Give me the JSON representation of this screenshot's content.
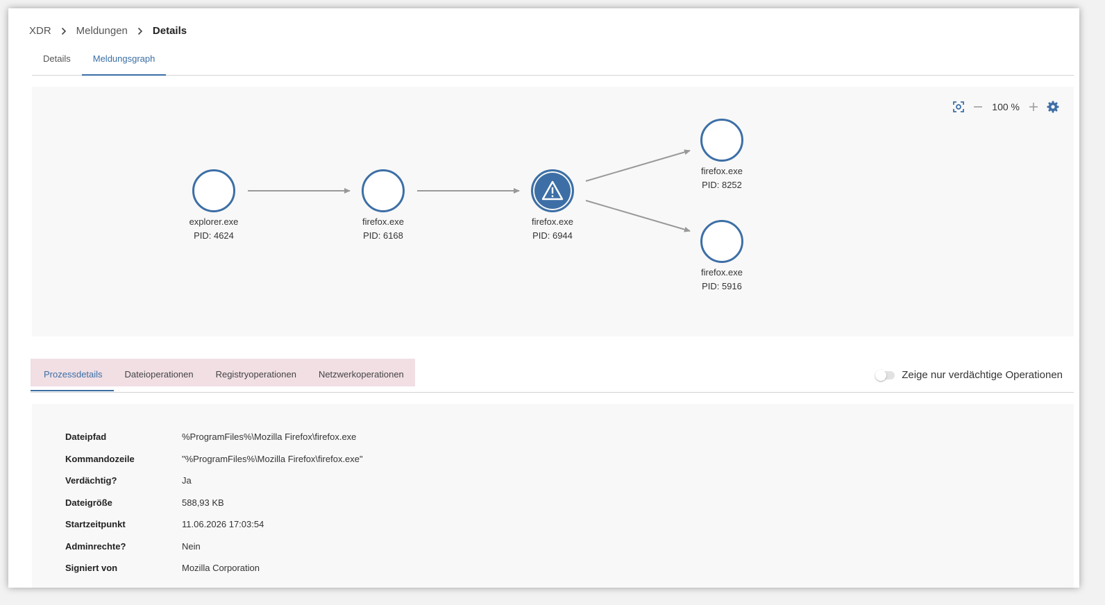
{
  "breadcrumb": [
    "XDR",
    "Meldungen",
    "Details"
  ],
  "top_tabs": [
    {
      "label": "Details",
      "active": false
    },
    {
      "label": "Meldungsgraph",
      "active": true
    }
  ],
  "graph": {
    "zoom": "100 %",
    "nodes": [
      {
        "name": "explorer.exe",
        "pid": "PID: 4624",
        "suspicious": false
      },
      {
        "name": "firefox.exe",
        "pid": "PID: 6168",
        "suspicious": false
      },
      {
        "name": "firefox.exe",
        "pid": "PID: 6944",
        "suspicious": true
      },
      {
        "name": "firefox.exe",
        "pid": "PID: 8252",
        "suspicious": false
      },
      {
        "name": "firefox.exe",
        "pid": "PID: 5916",
        "suspicious": false
      }
    ],
    "edges": [
      [
        0,
        1
      ],
      [
        1,
        2
      ],
      [
        2,
        3
      ],
      [
        2,
        4
      ]
    ],
    "icons": {
      "fit": "fit-screen-icon",
      "zoom_out": "minus-icon",
      "zoom_in": "plus-icon",
      "settings": "gear-icon"
    }
  },
  "bottom_tabs": [
    {
      "label": "Prozessdetails",
      "active": true
    },
    {
      "label": "Dateioperationen",
      "active": false
    },
    {
      "label": "Registryoperationen",
      "active": false
    },
    {
      "label": "Netzwerkoperationen",
      "active": false
    }
  ],
  "toggle": {
    "label": "Zeige nur verdächtige Operationen",
    "on": false
  },
  "process_details": [
    {
      "key": "Dateipfad",
      "value": "%ProgramFiles%\\Mozilla Firefox\\firefox.exe"
    },
    {
      "key": "Kommandozeile",
      "value": "\"%ProgramFiles%\\Mozilla Firefox\\firefox.exe\""
    },
    {
      "key": "Verdächtig?",
      "value": "Ja"
    },
    {
      "key": "Dateigröße",
      "value": "588,93 KB"
    },
    {
      "key": "Startzeitpunkt",
      "value": "11.06.2026 17:03:54"
    },
    {
      "key": "Adminrechte?",
      "value": "Nein"
    },
    {
      "key": "Signiert von",
      "value": "Mozilla Corporation"
    }
  ],
  "colors": {
    "accent": "#3d6fa6",
    "tab_highlight": "#f1dfe4",
    "edge": "#999999"
  }
}
